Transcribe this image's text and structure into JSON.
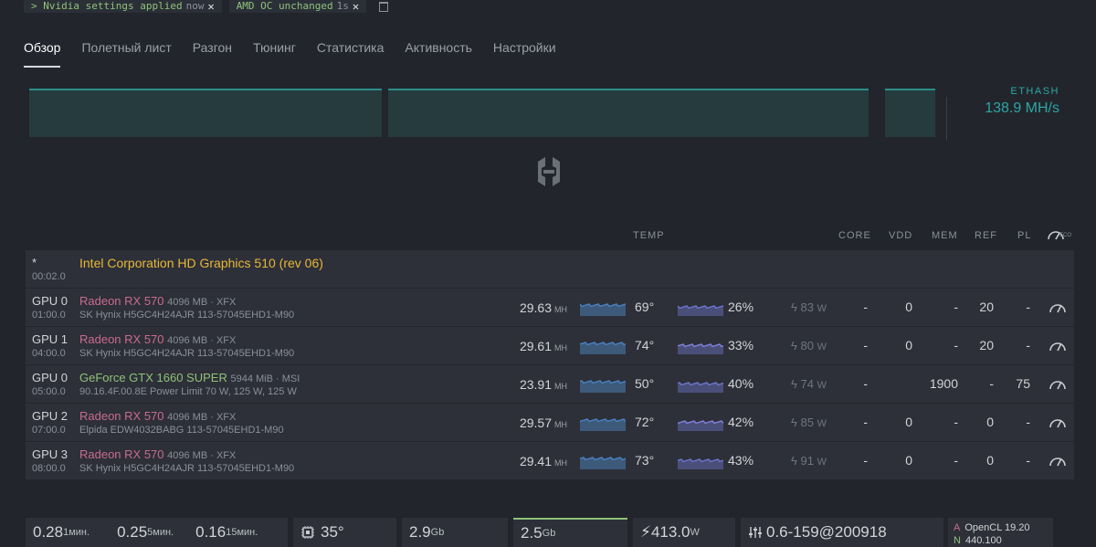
{
  "notifications": [
    {
      "message": "> Nvidia settings applied",
      "time": "now"
    },
    {
      "message": "AMD OC unchanged",
      "time": "1s"
    }
  ],
  "tabs": [
    "Обзор",
    "Полетный лист",
    "Разгон",
    "Тюнинг",
    "Статистика",
    "Активность",
    "Настройки"
  ],
  "hashrate": {
    "algo": "ETHASH",
    "value": "138.9 MH/s"
  },
  "table_header": {
    "temp": "TEMP",
    "core": "CORE",
    "vdd": "VDD",
    "mem": "MEM",
    "ref": "REF",
    "pl": "PL",
    "gauge_label": "ECO"
  },
  "igpu": {
    "index": "*",
    "bus": "00:02.0",
    "model": "Intel Corporation HD Graphics 510 (rev 06)"
  },
  "gpus": [
    {
      "index": "GPU 0",
      "bus": "01:00.0",
      "model": "Radeon RX 570",
      "vram": "4096 MB · XFX",
      "memory": "SK Hynix H5GC4H24AJR 113-57045EHD1-M90",
      "hashrate": "29.63",
      "unit": "MH",
      "temp": "69°",
      "fan": "26%",
      "power": "83",
      "power_unit": "W",
      "core": "-",
      "vdd": "0",
      "mem": "-",
      "ref": "20",
      "pl": "-",
      "vendor": "amd",
      "fan_color": "#6b73c8"
    },
    {
      "index": "GPU 1",
      "bus": "04:00.0",
      "model": "Radeon RX 570",
      "vram": "4096 MB · XFX",
      "memory": "SK Hynix H5GC4H24AJR 113-57045EHD1-M90",
      "hashrate": "29.61",
      "unit": "MH",
      "temp": "74°",
      "fan": "33%",
      "power": "80",
      "power_unit": "W",
      "core": "-",
      "vdd": "0",
      "mem": "-",
      "ref": "20",
      "pl": "-",
      "vendor": "amd",
      "fan_color": "#7d7fd8"
    },
    {
      "index": "GPU 0",
      "bus": "05:00.0",
      "model": "GeForce GTX 1660 SUPER",
      "vram": "5944 MiB · MSI",
      "memory": "90.16.4F.00.8E     Power Limit 70 W, 125 W, 125 W",
      "hashrate": "23.91",
      "unit": "MH",
      "temp": "50°",
      "fan": "40%",
      "power": "74",
      "power_unit": "W",
      "core": "-",
      "vdd": "",
      "mem": "1900",
      "ref": "-",
      "pl": "75",
      "vendor": "nv",
      "fan_color": "#6b73c8"
    },
    {
      "index": "GPU 2",
      "bus": "07:00.0",
      "model": "Radeon RX 570",
      "vram": "4096 MB · XFX",
      "memory": "Elpida EDW4032BABG 113-57045EHD1-M90",
      "hashrate": "29.57",
      "unit": "MH",
      "temp": "72°",
      "fan": "42%",
      "power": "85",
      "power_unit": "W",
      "core": "-",
      "vdd": "0",
      "mem": "-",
      "ref": "0",
      "pl": "-",
      "vendor": "amd",
      "fan_color": "#7d7fd8"
    },
    {
      "index": "GPU 3",
      "bus": "08:00.0",
      "model": "Radeon RX 570",
      "vram": "4096 MB · XFX",
      "memory": "SK Hynix H5GC4H24AJR 113-57045EHD1-M90",
      "hashrate": "29.41",
      "unit": "MH",
      "temp": "73°",
      "fan": "43%",
      "power": "91",
      "power_unit": "W",
      "core": "-",
      "vdd": "0",
      "mem": "-",
      "ref": "0",
      "pl": "-",
      "vendor": "amd",
      "fan_color": "#6b73c8"
    }
  ],
  "stats": {
    "la1": "0.28",
    "la1_unit": "1мин.",
    "la5": "0.25",
    "la5_unit": "5мин.",
    "la15": "0.16",
    "la15_unit": "15мин.",
    "cpu_temp": "35°",
    "ram": "2.9",
    "ram_unit": "Gb",
    "disk": "2.5",
    "disk_unit": "Gb",
    "power": "413.0",
    "power_unit": "W",
    "version": "0.6-159@200918",
    "driver_a_label": "A",
    "driver_a": "OpenCL 19.20",
    "driver_n_label": "N",
    "driver_n": "440.100"
  },
  "colors": {
    "accent": "#2ea6a4",
    "amd": "#c96a8f",
    "nvidia": "#8fc27a",
    "intel": "#e8b739",
    "spark": "#4a7fbf"
  }
}
